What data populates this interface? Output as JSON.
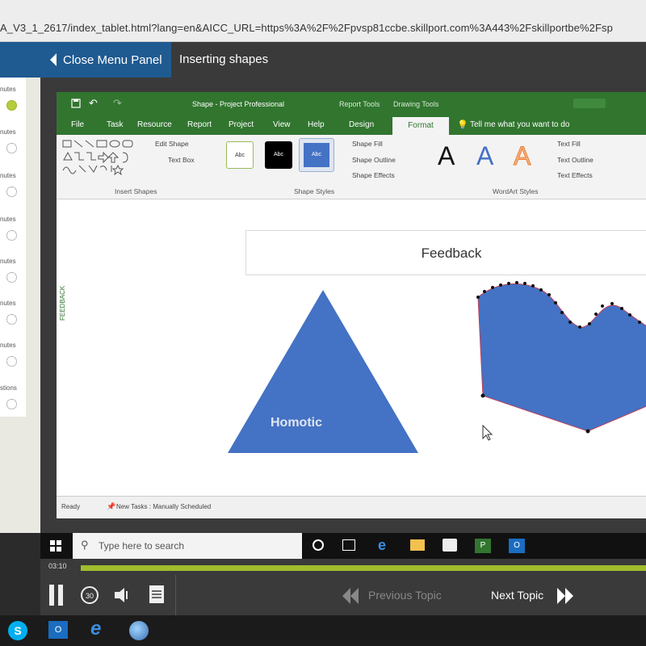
{
  "browser": {
    "url": "A_V3_1_2617/index_tablet.html?lang=en&AICC_URL=https%3A%2F%2Fpvsp81ccbe.skillport.com%3A443%2Fskillportbe%2Fsp"
  },
  "header": {
    "close_menu_label": "Close Menu Panel",
    "topic_title": "Inserting shapes"
  },
  "left_panel": {
    "items": [
      {
        "label": "nutes",
        "status": "complete"
      },
      {
        "label": "nutes",
        "status": "incomplete"
      },
      {
        "label": "nutes",
        "status": "incomplete"
      },
      {
        "label": "nutes",
        "status": "incomplete"
      },
      {
        "label": "nutes",
        "status": "incomplete"
      },
      {
        "label": "nutes",
        "status": "incomplete"
      },
      {
        "label": "nutes",
        "status": "incomplete"
      },
      {
        "label": "stions",
        "status": "incomplete"
      }
    ]
  },
  "app": {
    "window_title": "Shape - Project Professional",
    "context_groups": [
      "Report Tools",
      "Drawing Tools"
    ],
    "menu": [
      "File",
      "Task",
      "Resource",
      "Report",
      "Project",
      "View",
      "Help",
      "Design",
      "Format"
    ],
    "active_tab": "Format",
    "tell_me": "Tell me what you want to do",
    "ribbon": {
      "edit_shape": "Edit Shape",
      "text_box": "Text Box",
      "insert_shapes_label": "Insert Shapes",
      "style_sample": "Abc",
      "shape_fill": "Shape Fill",
      "shape_outline": "Shape Outline",
      "shape_effects": "Shape Effects",
      "shape_styles_label": "Shape Styles",
      "wordart_letter": "A",
      "text_fill": "Text Fill",
      "text_outline": "Text Outline",
      "text_effects": "Text Effects",
      "wordart_styles_label": "WordArt Styles"
    },
    "canvas": {
      "feedback_title": "Feedback",
      "triangle_label": "Homotic",
      "side_label": "FEEDBACK",
      "shape_color": "#4472c4"
    },
    "status": {
      "ready": "Ready",
      "new_tasks": "New Tasks : Manually Scheduled"
    }
  },
  "taskbar": {
    "search_placeholder": "Type here to search"
  },
  "player": {
    "time": "03:10",
    "progress_fraction": 1.0,
    "prev_label": "Previous Topic",
    "next_label": "Next Topic",
    "accent": "#9fbd2d"
  }
}
